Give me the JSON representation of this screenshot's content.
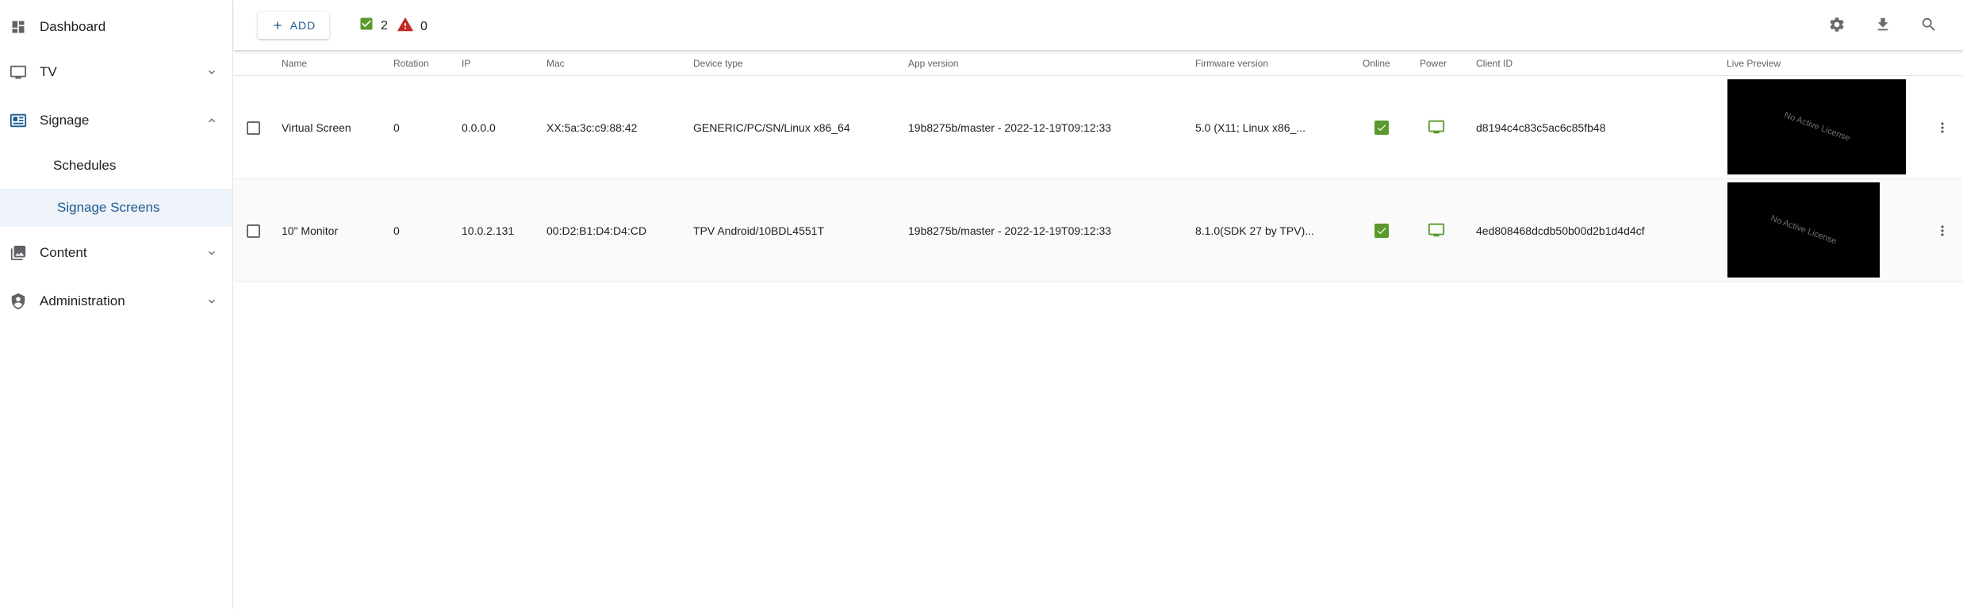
{
  "sidebar": {
    "items": [
      {
        "label": "Dashboard"
      },
      {
        "label": "TV"
      },
      {
        "label": "Signage"
      },
      {
        "label": "Schedules"
      },
      {
        "label": "Signage Screens"
      },
      {
        "label": "Content"
      },
      {
        "label": "Administration"
      }
    ]
  },
  "toolbar": {
    "add_label": "ADD",
    "online_count": "2",
    "warning_count": "0"
  },
  "table": {
    "columns": [
      "Name",
      "Rotation",
      "IP",
      "Mac",
      "Device type",
      "App version",
      "Firmware version",
      "Online",
      "Power",
      "Client ID",
      "Live Preview"
    ],
    "rows": [
      {
        "name": "Virtual Screen",
        "rotation": "0",
        "ip": "0.0.0.0",
        "mac": "XX:5a:3c:c9:88:42",
        "device_type": "GENERIC/PC/SN/Linux x86_64",
        "app_version": "19b8275b/master - 2022-12-19T09:12:33",
        "firmware_version": "5.0 (X11; Linux x86_...",
        "client_id": "d8194c4c83c5ac6c85fb48",
        "preview_text": "No Active License"
      },
      {
        "name": "10\" Monitor",
        "rotation": "0",
        "ip": "10.0.2.131",
        "mac": "00:D2:B1:D4:D4:CD",
        "device_type": "TPV Android/10BDL4551T",
        "app_version": "19b8275b/master - 2022-12-19T09:12:33",
        "firmware_version": "8.1.0(SDK 27 by TPV)...",
        "client_id": "4ed808468dcdb50b00d2b1d4d4cf",
        "preview_text": "No Active License"
      }
    ]
  },
  "colors": {
    "accent": "#1f5a8e",
    "success": "#5a9a2c",
    "danger": "#c62828",
    "selected_bg": "#eef4fa"
  }
}
